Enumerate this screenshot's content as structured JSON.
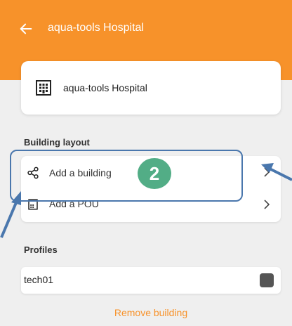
{
  "colors": {
    "accent": "#f7922a",
    "annotation_blue": "#4a77ad",
    "badge_green": "#52ad86",
    "background": "#efefef"
  },
  "header": {
    "title": "aqua-tools Hospital",
    "back_icon": "arrow-left-icon"
  },
  "hospital_card": {
    "icon": "building-icon",
    "name": "aqua-tools Hospital"
  },
  "building_layout": {
    "heading": "Building layout",
    "items": [
      {
        "label": "Add a building",
        "icon": "share-nodes-icon"
      },
      {
        "label": "Add a POU",
        "icon": "device-icon"
      }
    ]
  },
  "annotation": {
    "step_number": "2"
  },
  "profiles": {
    "heading": "Profiles",
    "items": [
      {
        "label": "tech01",
        "checked": true
      }
    ]
  },
  "footer": {
    "remove_label": "Remove building"
  }
}
